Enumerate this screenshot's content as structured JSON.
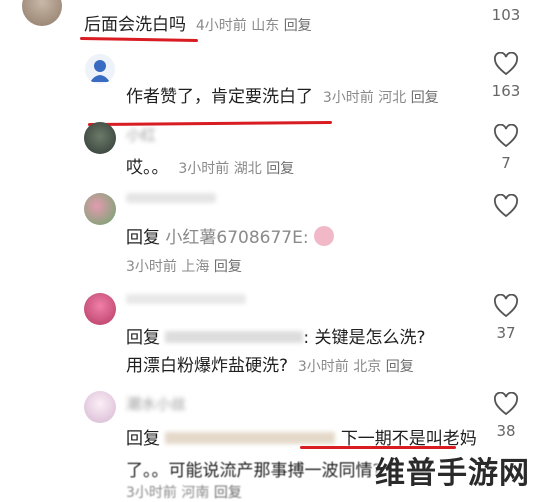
{
  "comments": [
    {
      "text": "后面会洗白吗",
      "time": "4小时前",
      "location": "山东",
      "reply_label": "回复",
      "likes": "103"
    },
    {
      "text": "作者赞了，肯定要洗白了",
      "time": "3小时前",
      "location": "河北",
      "reply_label": "回复",
      "likes": "163"
    },
    {
      "name": "小红",
      "text": "哎。。",
      "time": "3小时前",
      "location": "湖北",
      "reply_label": "回复",
      "likes": "7"
    },
    {
      "reply_prefix": "回复",
      "reply_to": "小红薯6708677E:",
      "time": "3小时前",
      "location": "上海",
      "reply_label": "回复"
    },
    {
      "reply_prefix": "回复",
      "text_line1": ": 关键是怎么洗?",
      "text_line2": "用漂白粉爆炸盐硬洗?",
      "time": "3小时前",
      "location": "北京",
      "reply_label": "回复",
      "likes": "37"
    },
    {
      "name": "潮水小丝",
      "reply_prefix": "回复",
      "text_line1": "下一期不是叫老妈",
      "text_line2": "了。。可能说流产那事搏一波同情?",
      "time": "3小时前",
      "location": "河南",
      "reply_label": "回复",
      "likes": "38"
    }
  ],
  "watermark": "维普手游网",
  "colors": {
    "underline": "#d81c22",
    "meta": "#8a8a8a"
  }
}
